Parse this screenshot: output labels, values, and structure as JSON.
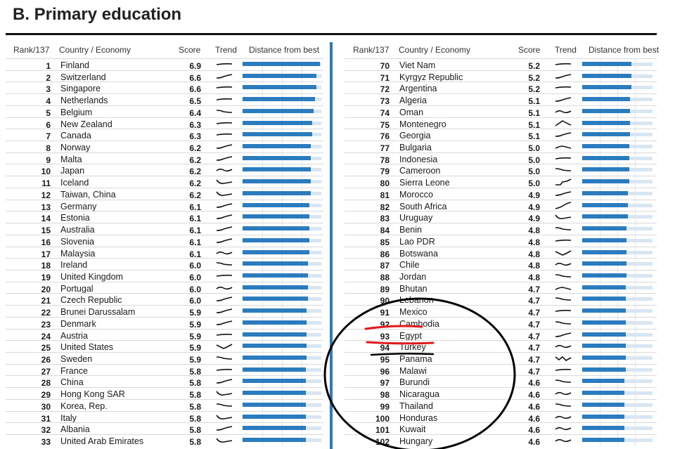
{
  "title": "B. Primary education",
  "headers": {
    "rank": "Rank/137",
    "country": "Country / Economy",
    "score": "Score",
    "trend": "Trend",
    "distance": "Distance from best"
  },
  "colors": {
    "bar": "#2b7bbf",
    "bar_bg": "#d7e6f2",
    "divider": "#2b7bbf",
    "annotation_red": "#e0191e",
    "annotation_black": "#000000"
  },
  "chart_data": {
    "type": "table",
    "max_score": 7,
    "left": [
      {
        "rank": "1",
        "country": "Finland",
        "score": "6.9",
        "trend": "flat"
      },
      {
        "rank": "2",
        "country": "Switzerland",
        "score": "6.6",
        "trend": "up"
      },
      {
        "rank": "3",
        "country": "Singapore",
        "score": "6.6",
        "trend": "flat"
      },
      {
        "rank": "4",
        "country": "Netherlands",
        "score": "6.5",
        "trend": "flat"
      },
      {
        "rank": "5",
        "country": "Belgium",
        "score": "6.4",
        "trend": "down"
      },
      {
        "rank": "6",
        "country": "New Zealand",
        "score": "6.3",
        "trend": "flat"
      },
      {
        "rank": "7",
        "country": "Canada",
        "score": "6.3",
        "trend": "flat"
      },
      {
        "rank": "8",
        "country": "Norway",
        "score": "6.2",
        "trend": "up"
      },
      {
        "rank": "9",
        "country": "Malta",
        "score": "6.2",
        "trend": "up"
      },
      {
        "rank": "10",
        "country": "Japan",
        "score": "6.2",
        "trend": "wave"
      },
      {
        "rank": "11",
        "country": "Iceland",
        "score": "6.2",
        "trend": "dip"
      },
      {
        "rank": "12",
        "country": "Taiwan, China",
        "score": "6.2",
        "trend": "dip"
      },
      {
        "rank": "13",
        "country": "Germany",
        "score": "6.1",
        "trend": "up"
      },
      {
        "rank": "14",
        "country": "Estonia",
        "score": "6.1",
        "trend": "up"
      },
      {
        "rank": "15",
        "country": "Australia",
        "score": "6.1",
        "trend": "up"
      },
      {
        "rank": "16",
        "country": "Slovenia",
        "score": "6.1",
        "trend": "up"
      },
      {
        "rank": "17",
        "country": "Malaysia",
        "score": "6.1",
        "trend": "wave"
      },
      {
        "rank": "18",
        "country": "Ireland",
        "score": "6.0",
        "trend": "down"
      },
      {
        "rank": "19",
        "country": "United Kingdom",
        "score": "6.0",
        "trend": "flat"
      },
      {
        "rank": "20",
        "country": "Portugal",
        "score": "6.0",
        "trend": "wave"
      },
      {
        "rank": "21",
        "country": "Czech Republic",
        "score": "6.0",
        "trend": "up"
      },
      {
        "rank": "22",
        "country": "Brunei Darussalam",
        "score": "5.9",
        "trend": "up"
      },
      {
        "rank": "23",
        "country": "Denmark",
        "score": "5.9",
        "trend": "up"
      },
      {
        "rank": "24",
        "country": "Austria",
        "score": "5.9",
        "trend": "flat"
      },
      {
        "rank": "25",
        "country": "United States",
        "score": "5.9",
        "trend": "vee"
      },
      {
        "rank": "26",
        "country": "Sweden",
        "score": "5.9",
        "trend": "down"
      },
      {
        "rank": "27",
        "country": "France",
        "score": "5.8",
        "trend": "flat"
      },
      {
        "rank": "28",
        "country": "China",
        "score": "5.8",
        "trend": "up"
      },
      {
        "rank": "29",
        "country": "Hong Kong SAR",
        "score": "5.8",
        "trend": "dip"
      },
      {
        "rank": "30",
        "country": "Korea, Rep.",
        "score": "5.8",
        "trend": "down"
      },
      {
        "rank": "31",
        "country": "Italy",
        "score": "5.8",
        "trend": "dip"
      },
      {
        "rank": "32",
        "country": "Albania",
        "score": "5.8",
        "trend": "up"
      },
      {
        "rank": "33",
        "country": "United Arab Emirates",
        "score": "5.8",
        "trend": "dip"
      }
    ],
    "right": [
      {
        "rank": "70",
        "country": "Viet Nam",
        "score": "5.2",
        "trend": "flat"
      },
      {
        "rank": "71",
        "country": "Kyrgyz Republic",
        "score": "5.2",
        "trend": "up"
      },
      {
        "rank": "72",
        "country": "Argentina",
        "score": "5.2",
        "trend": "flat"
      },
      {
        "rank": "73",
        "country": "Algeria",
        "score": "5.1",
        "trend": "up"
      },
      {
        "rank": "74",
        "country": "Oman",
        "score": "5.1",
        "trend": "wave"
      },
      {
        "rank": "75",
        "country": "Montenegro",
        "score": "5.1",
        "trend": "peak"
      },
      {
        "rank": "76",
        "country": "Georgia",
        "score": "5.1",
        "trend": "up"
      },
      {
        "rank": "77",
        "country": "Bulgaria",
        "score": "5.0",
        "trend": "hump"
      },
      {
        "rank": "78",
        "country": "Indonesia",
        "score": "5.0",
        "trend": "flat"
      },
      {
        "rank": "79",
        "country": "Cameroon",
        "score": "5.0",
        "trend": "down"
      },
      {
        "rank": "80",
        "country": "Sierra Leone",
        "score": "5.0",
        "trend": "steps"
      },
      {
        "rank": "81",
        "country": "Morocco",
        "score": "4.9",
        "trend": "up"
      },
      {
        "rank": "82",
        "country": "South Africa",
        "score": "4.9",
        "trend": "rise"
      },
      {
        "rank": "83",
        "country": "Uruguay",
        "score": "4.9",
        "trend": "dip"
      },
      {
        "rank": "84",
        "country": "Benin",
        "score": "4.8",
        "trend": "down"
      },
      {
        "rank": "85",
        "country": "Lao PDR",
        "score": "4.8",
        "trend": "flat"
      },
      {
        "rank": "86",
        "country": "Botswana",
        "score": "4.8",
        "trend": "vee"
      },
      {
        "rank": "87",
        "country": "Chile",
        "score": "4.8",
        "trend": "wave"
      },
      {
        "rank": "88",
        "country": "Jordan",
        "score": "4.8",
        "trend": "down"
      },
      {
        "rank": "89",
        "country": "Bhutan",
        "score": "4.7",
        "trend": "hump"
      },
      {
        "rank": "90",
        "country": "Lebanon",
        "score": "4.7",
        "trend": "down"
      },
      {
        "rank": "91",
        "country": "Mexico",
        "score": "4.7",
        "trend": "flat"
      },
      {
        "rank": "92",
        "country": "Cambodia",
        "score": "4.7",
        "trend": "down"
      },
      {
        "rank": "93",
        "country": "Egypt",
        "score": "4.7",
        "trend": "up"
      },
      {
        "rank": "94",
        "country": "Turkey",
        "score": "4.7",
        "trend": "wave"
      },
      {
        "rank": "95",
        "country": "Panama",
        "score": "4.7",
        "trend": "zigzag"
      },
      {
        "rank": "96",
        "country": "Malawi",
        "score": "4.7",
        "trend": "flat"
      },
      {
        "rank": "97",
        "country": "Burundi",
        "score": "4.6",
        "trend": "down"
      },
      {
        "rank": "98",
        "country": "Nicaragua",
        "score": "4.6",
        "trend": "wave"
      },
      {
        "rank": "99",
        "country": "Thailand",
        "score": "4.6",
        "trend": "down"
      },
      {
        "rank": "100",
        "country": "Honduras",
        "score": "4.6",
        "trend": "wave"
      },
      {
        "rank": "101",
        "country": "Kuwait",
        "score": "4.6",
        "trend": "wave"
      },
      {
        "rank": "102",
        "country": "Hungary",
        "score": "4.6",
        "trend": "wave"
      }
    ]
  }
}
